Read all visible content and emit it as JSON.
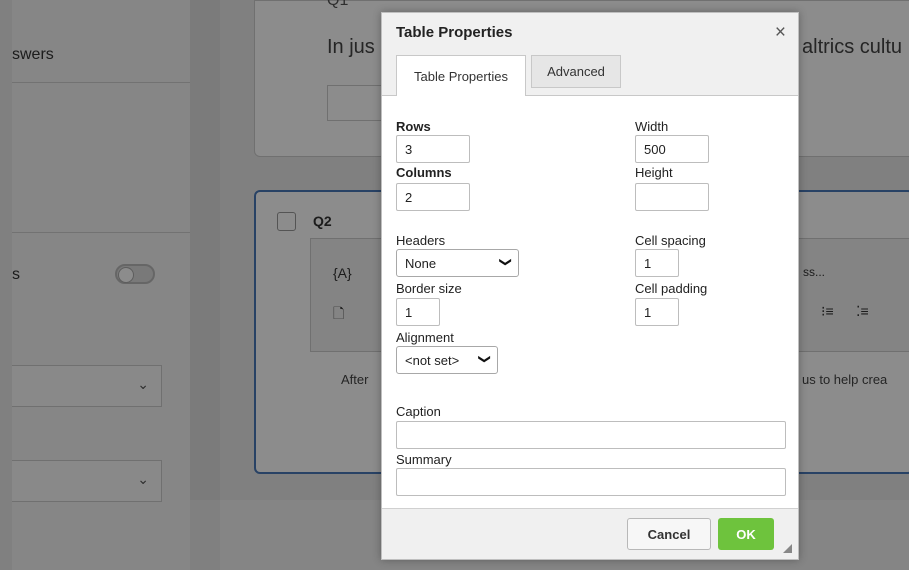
{
  "background": {
    "left_label_1": "swers",
    "left_label_2": "s",
    "chevron": "⌄",
    "q1_label": "Q1",
    "q1_text": "In jus",
    "q1_text_right": "altrics cultu",
    "q2_label": "Q2",
    "toolbar_item_1": "{A}",
    "toolbar_item_2": "ss...",
    "editor_text_left": "After",
    "editor_text_right": "us to help crea"
  },
  "dialog": {
    "title": "Table Properties",
    "close_symbol": "×",
    "tabs": [
      {
        "label": "Table Properties",
        "active": true
      },
      {
        "label": "Advanced",
        "active": false
      }
    ],
    "rows_label": "Rows",
    "rows_value": "3",
    "columns_label": "Columns",
    "columns_value": "2",
    "headers_label": "Headers",
    "headers_value": "None",
    "border_size_label": "Border size",
    "border_size_value": "1",
    "alignment_label": "Alignment",
    "alignment_value": "<not set>",
    "width_label": "Width",
    "width_value": "500",
    "height_label": "Height",
    "height_value": "",
    "cell_spacing_label": "Cell spacing",
    "cell_spacing_value": "1",
    "cell_padding_label": "Cell padding",
    "cell_padding_value": "1",
    "caption_label": "Caption",
    "caption_value": "",
    "summary_label": "Summary",
    "summary_value": "",
    "cancel_label": "Cancel",
    "ok_label": "OK"
  },
  "colors": {
    "ok_button": "#6ec33d",
    "focus_border": "#4a78b8"
  }
}
